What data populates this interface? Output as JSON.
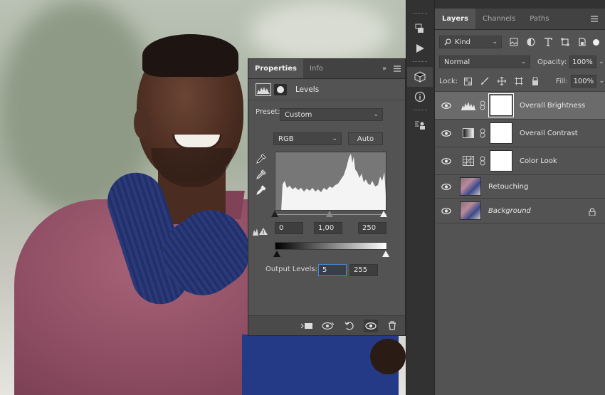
{
  "properties_panel": {
    "tabs": [
      {
        "label": "Properties"
      },
      {
        "label": "Info"
      }
    ],
    "expand_glyph": "»",
    "title": "Levels",
    "preset_label": "Preset:",
    "preset_value": "Custom",
    "channel_value": "RGB",
    "auto_label": "Auto",
    "input_levels": {
      "black": "0",
      "gamma": "1,00",
      "white": "250"
    },
    "output_label": "Output Levels:",
    "output_levels": {
      "black": "5",
      "white": "255"
    }
  },
  "layers_panel": {
    "tabs": [
      {
        "label": "Layers"
      },
      {
        "label": "Channels"
      },
      {
        "label": "Paths"
      }
    ],
    "filter_kind": "Kind",
    "blend_mode": "Normal",
    "opacity_label": "Opacity:",
    "opacity_value": "100%",
    "lock_label": "Lock:",
    "fill_label": "Fill:",
    "fill_value": "100%",
    "layers": [
      {
        "name": "Overall Brightness",
        "type": "levels",
        "selected": true
      },
      {
        "name": "Overall Contrast",
        "type": "gradient-map"
      },
      {
        "name": "Color Look",
        "type": "color-lookup"
      },
      {
        "name": "Retouching",
        "type": "pixel"
      },
      {
        "name": "Background",
        "type": "pixel",
        "locked": true
      }
    ]
  },
  "colors": {
    "panel_bg": "#535353",
    "tab_bar_bg": "#424242",
    "selected_layer_bg": "#6b6b6b",
    "focus_blue": "#4b8ad6"
  }
}
